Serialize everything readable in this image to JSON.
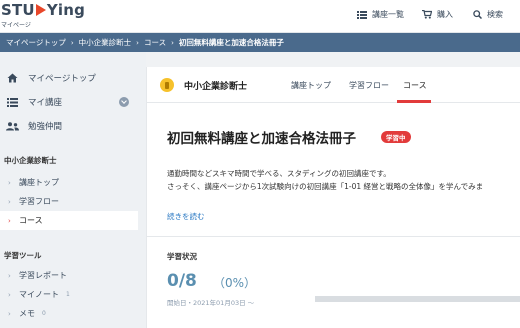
{
  "header": {
    "logo_text_a": "STU",
    "logo_text_b": "Ying",
    "logo_sub": "マイページ",
    "course_list_label": "講座一覧",
    "cart_label": "購入",
    "search_label": "検索"
  },
  "breadcrumb": {
    "items": [
      "マイページトップ",
      "中小企業診断士",
      "コース",
      "初回無料講座と加速合格法冊子"
    ],
    "separator": "›"
  },
  "sidebar": {
    "main_items": [
      {
        "label": "マイページトップ",
        "icon": "home-icon"
      },
      {
        "label": "マイ講座",
        "icon": "list-icon"
      },
      {
        "label": "勉強仲間",
        "icon": "people-icon"
      }
    ],
    "exam_section_title": "中小企業診断士",
    "exam_items": [
      {
        "label": "講座トップ",
        "active": false
      },
      {
        "label": "学習フロー",
        "active": false
      },
      {
        "label": "コース",
        "active": true
      }
    ],
    "tools_section_title": "学習ツール",
    "tool_items": [
      {
        "label": "学習レポート",
        "count": ""
      },
      {
        "label": "マイノート",
        "count": "1"
      },
      {
        "label": "メモ",
        "count": "0"
      }
    ]
  },
  "main": {
    "exam_name": "中小企業診断士",
    "tabs": [
      "講座トップ",
      "学習フロー",
      "コース"
    ],
    "active_tab": "コース",
    "course_title": "初回無料講座と加速合格法冊子",
    "badge": "学習中",
    "description_line1": "通勤時間などスキマ時間で学べる、スタディングの初回講座です。",
    "description_line2": "さっそく、講座ページから1次試験向けの初回講座「1-01 経営と戦略の全体像」を学んでみま",
    "read_more": "続きを読む",
    "status_label": "学習状況",
    "progress_count": "0/8",
    "progress_percent": "（0%）",
    "progress_fraction": 0,
    "start_date": "開始日・2021年01月03日 〜"
  },
  "colors": {
    "accent_red": "#e23b3b",
    "progress_blue": "#5a8fb0",
    "breadcrumb_bg": "#4a6a8c",
    "link_blue": "#2e7bc4"
  }
}
